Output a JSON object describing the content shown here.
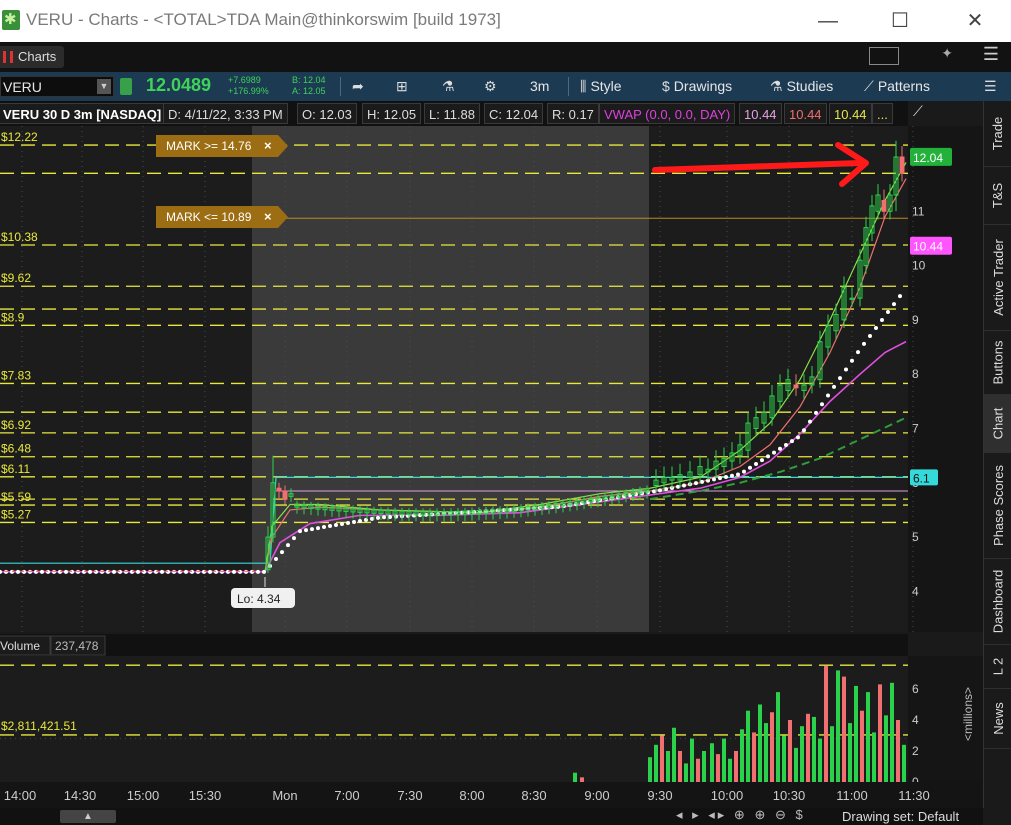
{
  "window": {
    "title": "VERU - Charts - <TOTAL>TDA Main@thinkorswim [build 1973]",
    "minimize": "—",
    "maximize": "☐",
    "close": "✕"
  },
  "tabstrip": {
    "charts_tab": "Charts"
  },
  "toolbar": {
    "symbol": "VERU",
    "last_price": "12.0489",
    "net_change": "+7.6989",
    "pct_change": "+176.99%",
    "bid": "B: 12.04",
    "ask": "A: 12.05",
    "timeframe": "3m",
    "style": "Style",
    "drawings": "Drawings",
    "studies": "Studies",
    "patterns": "Patterns"
  },
  "chart_header": {
    "symbol_period": "VERU 30 D 3m [NASDAQ]",
    "date": "D: 4/11/22, 3:33 PM",
    "open": "O: 12.03",
    "high": "H: 12.05",
    "low": "L: 11.88",
    "close": "C: 12.04",
    "range": "R: 0.17",
    "vwap_label": "VWAP (0.0, 0.0, DAY)",
    "vwap_v1": "10.44",
    "vwap_v2": "10.44",
    "vwap_v3": "10.44",
    "more": "..."
  },
  "alerts": {
    "upper": "MARK >= 14.76",
    "lower": "MARK <= 10.89",
    "close_icon": "×"
  },
  "price_chart": {
    "y_ticks": [
      "11",
      "10",
      "9",
      "8",
      "7",
      "6",
      "5",
      "4"
    ],
    "level_labels": [
      "12.22",
      "10.38",
      "9.62",
      "8.9",
      "7.83",
      "6.92",
      "6.48",
      "6.11",
      "5.59",
      "5.27"
    ],
    "last_badge": "12.04",
    "vwap_badge": "10.44",
    "cyan_badge": "6.1",
    "low_bubble": "Lo: 4.34"
  },
  "volume_pane": {
    "title": "Volume",
    "total": "237,478",
    "avg_label": "2,811,421.51",
    "unit": "<millions>",
    "y_ticks": [
      "6",
      "4",
      "2",
      "0"
    ]
  },
  "x_axis": [
    "14:00",
    "14:30",
    "15:00",
    "15:30",
    "Mon",
    "7:00",
    "7:30",
    "8:00",
    "8:30",
    "9:00",
    "9:30",
    "10:00",
    "10:30",
    "11:00",
    "11:30"
  ],
  "side_tabs": [
    "Trade",
    "T&S",
    "Active Trader",
    "Buttons",
    "Chart",
    "Phase Scores",
    "Dashboard",
    "L 2",
    "News"
  ],
  "bottom": {
    "drawing_set": "Drawing set: Default",
    "nav_glyphs": "◂ ▸ ◂▸ ⊕ ⊕ ⊖ $"
  },
  "colors": {
    "up": "#2bd14a",
    "down": "#f07070",
    "level": "#e8e83c",
    "cyan": "#35d9d9",
    "vwap": "#ff55ff",
    "accent_arrow": "#ff1a1a"
  }
}
